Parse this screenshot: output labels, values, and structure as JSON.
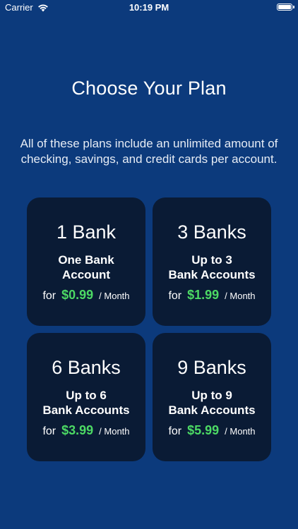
{
  "status_bar": {
    "carrier": "Carrier",
    "time": "10:19 PM",
    "wifi_icon": "wifi-icon",
    "battery_icon": "battery-icon"
  },
  "title": "Choose Your Plan",
  "description": "All of these plans include an unlimited amount of checking, savings, and credit cards per account.",
  "colors": {
    "background": "#0c3a7c",
    "card_background": "#0a1b35",
    "price_green": "#4cd964"
  },
  "plans": [
    {
      "name": "1 Bank",
      "desc_line1": "One Bank",
      "desc_line2": "Account",
      "for_label": "for",
      "price": "$0.99",
      "period": "/ Month"
    },
    {
      "name": "3 Banks",
      "desc_line1": "Up to 3",
      "desc_line2": "Bank Accounts",
      "for_label": "for",
      "price": "$1.99",
      "period": "/ Month"
    },
    {
      "name": "6 Banks",
      "desc_line1": "Up to 6",
      "desc_line2": "Bank Accounts",
      "for_label": "for",
      "price": "$3.99",
      "period": "/ Month"
    },
    {
      "name": "9 Banks",
      "desc_line1": "Up to 9",
      "desc_line2": "Bank Accounts",
      "for_label": "for",
      "price": "$5.99",
      "period": "/ Month"
    }
  ]
}
